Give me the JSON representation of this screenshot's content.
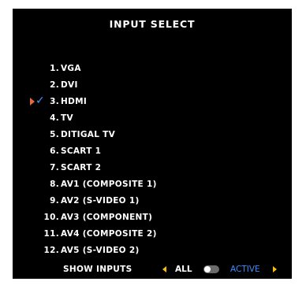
{
  "osd": {
    "title": "INPUT SELECT",
    "items": [
      {
        "num": "1.",
        "label": "VGA"
      },
      {
        "num": "2.",
        "label": "DVI"
      },
      {
        "num": "3.",
        "label": "HDMI",
        "selected": true
      },
      {
        "num": "4.",
        "label": "TV"
      },
      {
        "num": "5.",
        "label": "DITIGAL TV"
      },
      {
        "num": "6.",
        "label": "SCART 1"
      },
      {
        "num": "7.",
        "label": "SCART 2"
      },
      {
        "num": "8.",
        "label": "AV1 (COMPOSITE 1)"
      },
      {
        "num": "9.",
        "label": "AV2 (S-VIDEO 1)"
      },
      {
        "num": "10.",
        "label": "AV3 (COMPONENT)"
      },
      {
        "num": "11.",
        "label": "AV4 (COMPOSITE 2)"
      },
      {
        "num": "12.",
        "label": "AV5 (S-VIDEO 2)"
      }
    ],
    "selected_marker_icon": "triangle-right",
    "check_icon": "checkmark",
    "show_inputs": {
      "label": "SHOW INPUTS",
      "option_all": "ALL",
      "option_active": "ACTIVE",
      "current": "ACTIVE"
    },
    "colors": {
      "background": "#000000",
      "text": "#ffffff",
      "arrow": "#f3c300",
      "active_option": "#3a8cff",
      "marker": "#e66a3c",
      "check": "#3f9bff"
    }
  }
}
